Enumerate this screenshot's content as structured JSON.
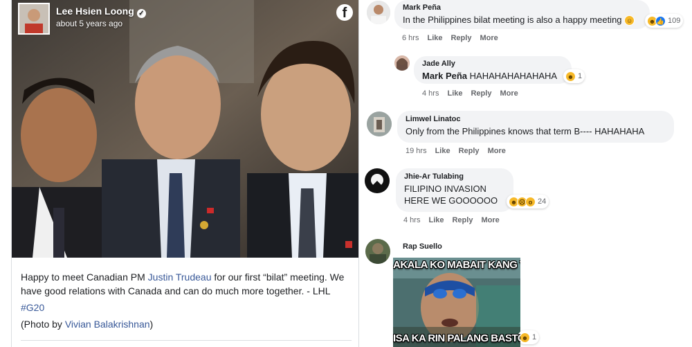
{
  "post": {
    "author": "Lee Hsien Loong",
    "time": "about 5 years ago",
    "caption_before_link": "Happy to meet Canadian PM ",
    "caption_link": "Justin Trudeau",
    "caption_after_link": " for our first “bilat” meeting. We have good relations with Canada and can do much more together. - LHL",
    "hashtag": "#G20",
    "credit_prefix": "(Photo by ",
    "credit_name": "Vivian Balakrishnan",
    "credit_suffix": ")",
    "brand_icon": "f"
  },
  "comments": [
    {
      "name": "Mark Peña",
      "text": "In the Philippines bilat meeting is also a happy meeting",
      "reactions": {
        "emojis": [
          "haha",
          "haha",
          "like"
        ],
        "count": "109"
      },
      "time": "6 hrs",
      "like": "Like",
      "reply": "Reply",
      "more": "More"
    },
    {
      "name": "Jade Ally",
      "mention": "Mark Peña",
      "text": " HAHAHAHAHAHAHA",
      "reactions": {
        "emojis": [
          "haha"
        ],
        "count": "1"
      },
      "time": "4 hrs",
      "like": "Like",
      "reply": "Reply",
      "more": "More"
    },
    {
      "name": "Limwel Linatoc",
      "text": "Only from the Philippines knows that term B---- HAHAHAHA",
      "time": "19 hrs",
      "like": "Like",
      "reply": "Reply",
      "more": "More"
    },
    {
      "name": "Jhie-Ar Tulabing",
      "text_line1": "FILIPINO INVASION",
      "text_line2": "HERE WE GOOOOOO",
      "reactions": {
        "emojis": [
          "haha",
          "sad",
          "wow"
        ],
        "count": "24"
      },
      "time": "4 hrs",
      "like": "Like",
      "reply": "Reply",
      "more": "More"
    },
    {
      "name": "Rap Suello",
      "meme_top": "AKALA KO MABAIT KANG TAO",
      "meme_bottom": "ISA KA RIN PALANG BASTOS",
      "reactions": {
        "emojis": [
          "haha"
        ],
        "count": "1"
      }
    }
  ],
  "colors": {
    "link": "#385898",
    "bubble": "#f2f3f5",
    "meta": "#65676b"
  }
}
